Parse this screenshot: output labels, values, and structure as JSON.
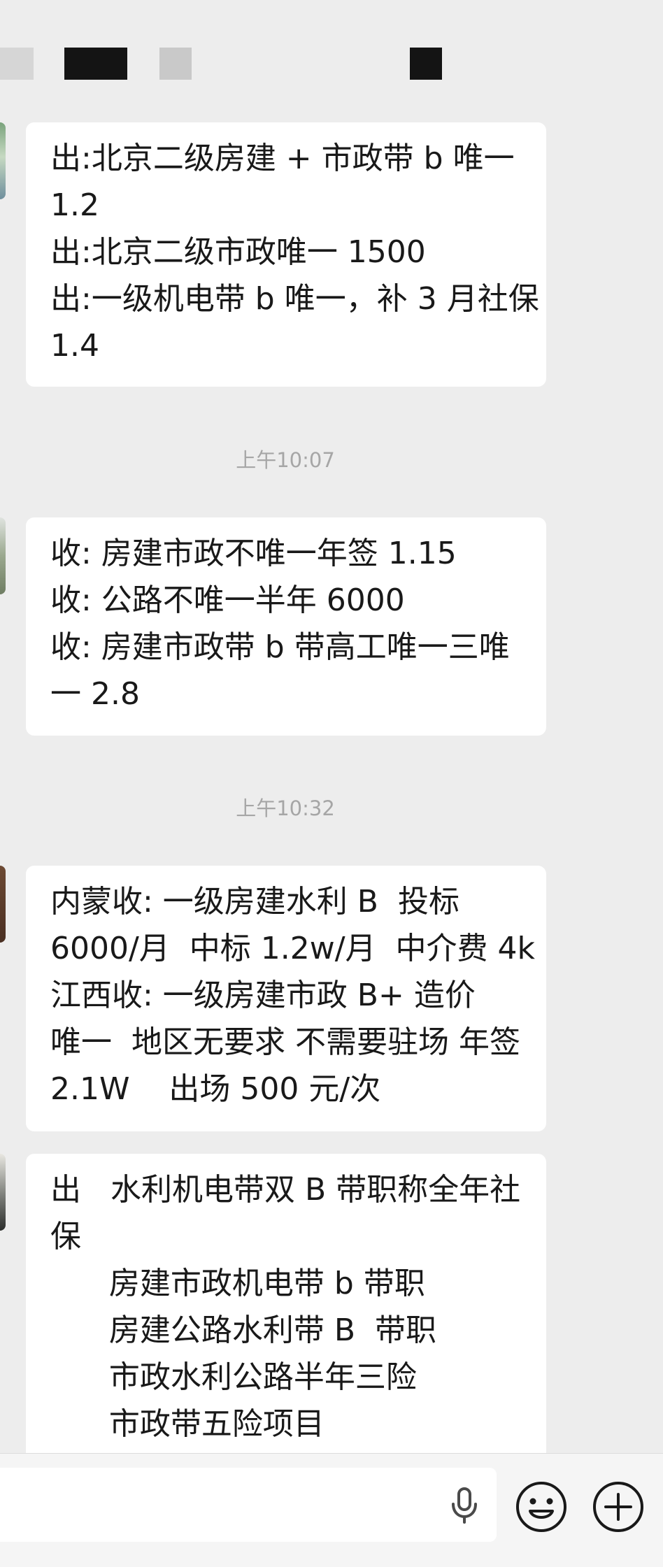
{
  "messages": [
    {
      "lines": [
        "出:北京二级房建 + 市政带 b 唯一",
        "1.2",
        "出:北京二级市政唯一 1500",
        "出:一级机电带 b 唯一，补 3 月社保",
        "1.4"
      ]
    },
    {
      "lines": [
        "收: 房建市政不唯一年签 1.15",
        "收: 公路不唯一半年 6000",
        "收: 房建市政带 b 带高工唯一三唯",
        "一 2.8"
      ]
    },
    {
      "lines": [
        "内蒙收: 一级房建水利 B  投标",
        "6000/月  中标 1.2w/月  中介费 4k",
        "江西收: 一级房建市政 B+ 造价",
        "唯一  地区无要求 不需要驻场 年签",
        "2.1W    出场 500 元/次"
      ]
    },
    {
      "lines": [
        "出   水利机电带双 B 带职称全年社",
        "保",
        "      房建市政机电带 b 带职",
        "      房建公路水利带 B  带职",
        "      市政水利公路半年三险",
        "      市政带五险项目"
      ]
    }
  ],
  "timestamps": [
    "上午10:07",
    "上午10:32"
  ],
  "input": {
    "value": "",
    "voice_icon": "microphone-icon",
    "emoji_icon": "smiley-face-icon",
    "add_icon": "plus-circle-icon"
  },
  "colors": {
    "background": "#ededed",
    "bubble": "#ffffff",
    "text": "#191919",
    "timestamp": "#a6a6a6"
  }
}
